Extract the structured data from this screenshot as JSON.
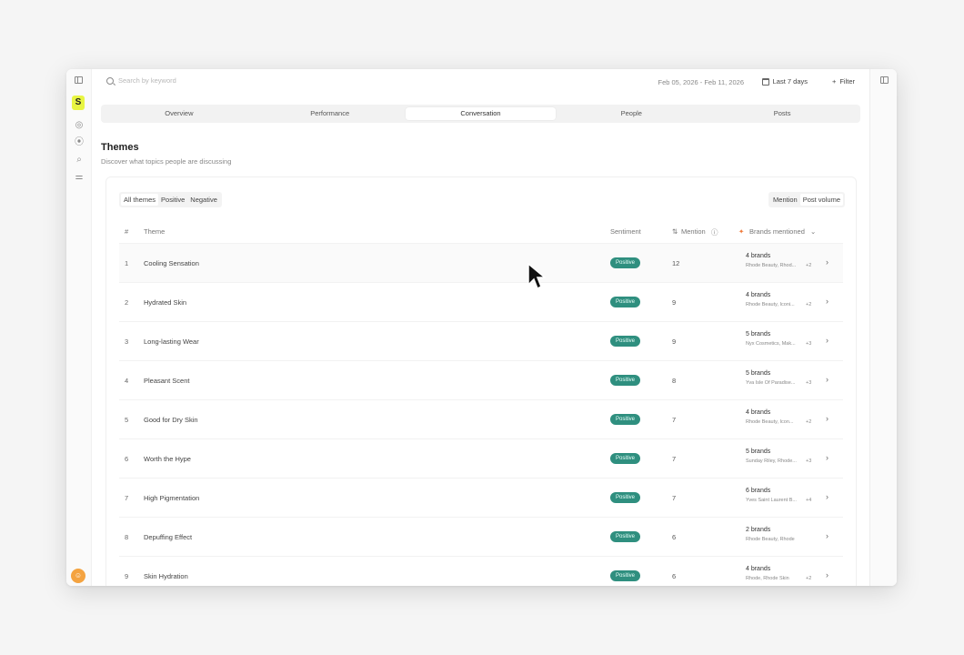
{
  "topbar": {
    "search_placeholder": "Search by keyword",
    "date_range": "Feb 05, 2026 - Feb 11, 2026",
    "period_label": "Last 7 days",
    "filter_label": "Filter"
  },
  "tabs": [
    {
      "label": "Overview"
    },
    {
      "label": "Performance"
    },
    {
      "label": "Conversation",
      "active": true
    },
    {
      "label": "People"
    },
    {
      "label": "Posts"
    }
  ],
  "section": {
    "title": "Themes",
    "subtitle": "Discover what topics people are discussing"
  },
  "filters": {
    "sentiment": [
      "All themes",
      "Positive",
      "Negative"
    ],
    "metric": [
      "Mention",
      "Post volume"
    ]
  },
  "table": {
    "headers": {
      "num": "#",
      "theme": "Theme",
      "sentiment": "Sentiment",
      "mention": "Mention",
      "brands": "Brands mentioned"
    },
    "rows": [
      {
        "num": "1",
        "theme": "Cooling Sensation",
        "sentiment": "Positive",
        "mention": "12",
        "brands": "4 brands",
        "brands_list": "Rhode Beauty, Rhod...",
        "more": "+2"
      },
      {
        "num": "2",
        "theme": "Hydrated Skin",
        "sentiment": "Positive",
        "mention": "9",
        "brands": "4 brands",
        "brands_list": "Rhode Beauty, Iconi...",
        "more": "+2"
      },
      {
        "num": "3",
        "theme": "Long-lasting Wear",
        "sentiment": "Positive",
        "mention": "9",
        "brands": "5 brands",
        "brands_list": "Nyx Cosmetics, Mak...",
        "more": "+3"
      },
      {
        "num": "4",
        "theme": "Pleasant Scent",
        "sentiment": "Positive",
        "mention": "8",
        "brands": "5 brands",
        "brands_list": "Yva Isle Of Paradise...",
        "more": "+3"
      },
      {
        "num": "5",
        "theme": "Good for Dry Skin",
        "sentiment": "Positive",
        "mention": "7",
        "brands": "4 brands",
        "brands_list": "Rhode Beauty, Icon...",
        "more": "+2"
      },
      {
        "num": "6",
        "theme": "Worth the Hype",
        "sentiment": "Positive",
        "mention": "7",
        "brands": "5 brands",
        "brands_list": "Sunday Riley, Rhode...",
        "more": "+3"
      },
      {
        "num": "7",
        "theme": "High Pigmentation",
        "sentiment": "Positive",
        "mention": "7",
        "brands": "6 brands",
        "brands_list": "Yves Saint Laurent B...",
        "more": "+4"
      },
      {
        "num": "8",
        "theme": "Depuffing Effect",
        "sentiment": "Positive",
        "mention": "6",
        "brands": "2 brands",
        "brands_list": "Rhode Beauty, Rhode",
        "more": ""
      },
      {
        "num": "9",
        "theme": "Skin Hydration",
        "sentiment": "Positive",
        "mention": "6",
        "brands": "4 brands",
        "brands_list": "Rhode, Rhode Skin",
        "more": "+2"
      }
    ]
  },
  "colors": {
    "positive_badge": "#2f8f7f",
    "logo_bg": "#e8f542",
    "avatar_bg": "#f4a340"
  }
}
